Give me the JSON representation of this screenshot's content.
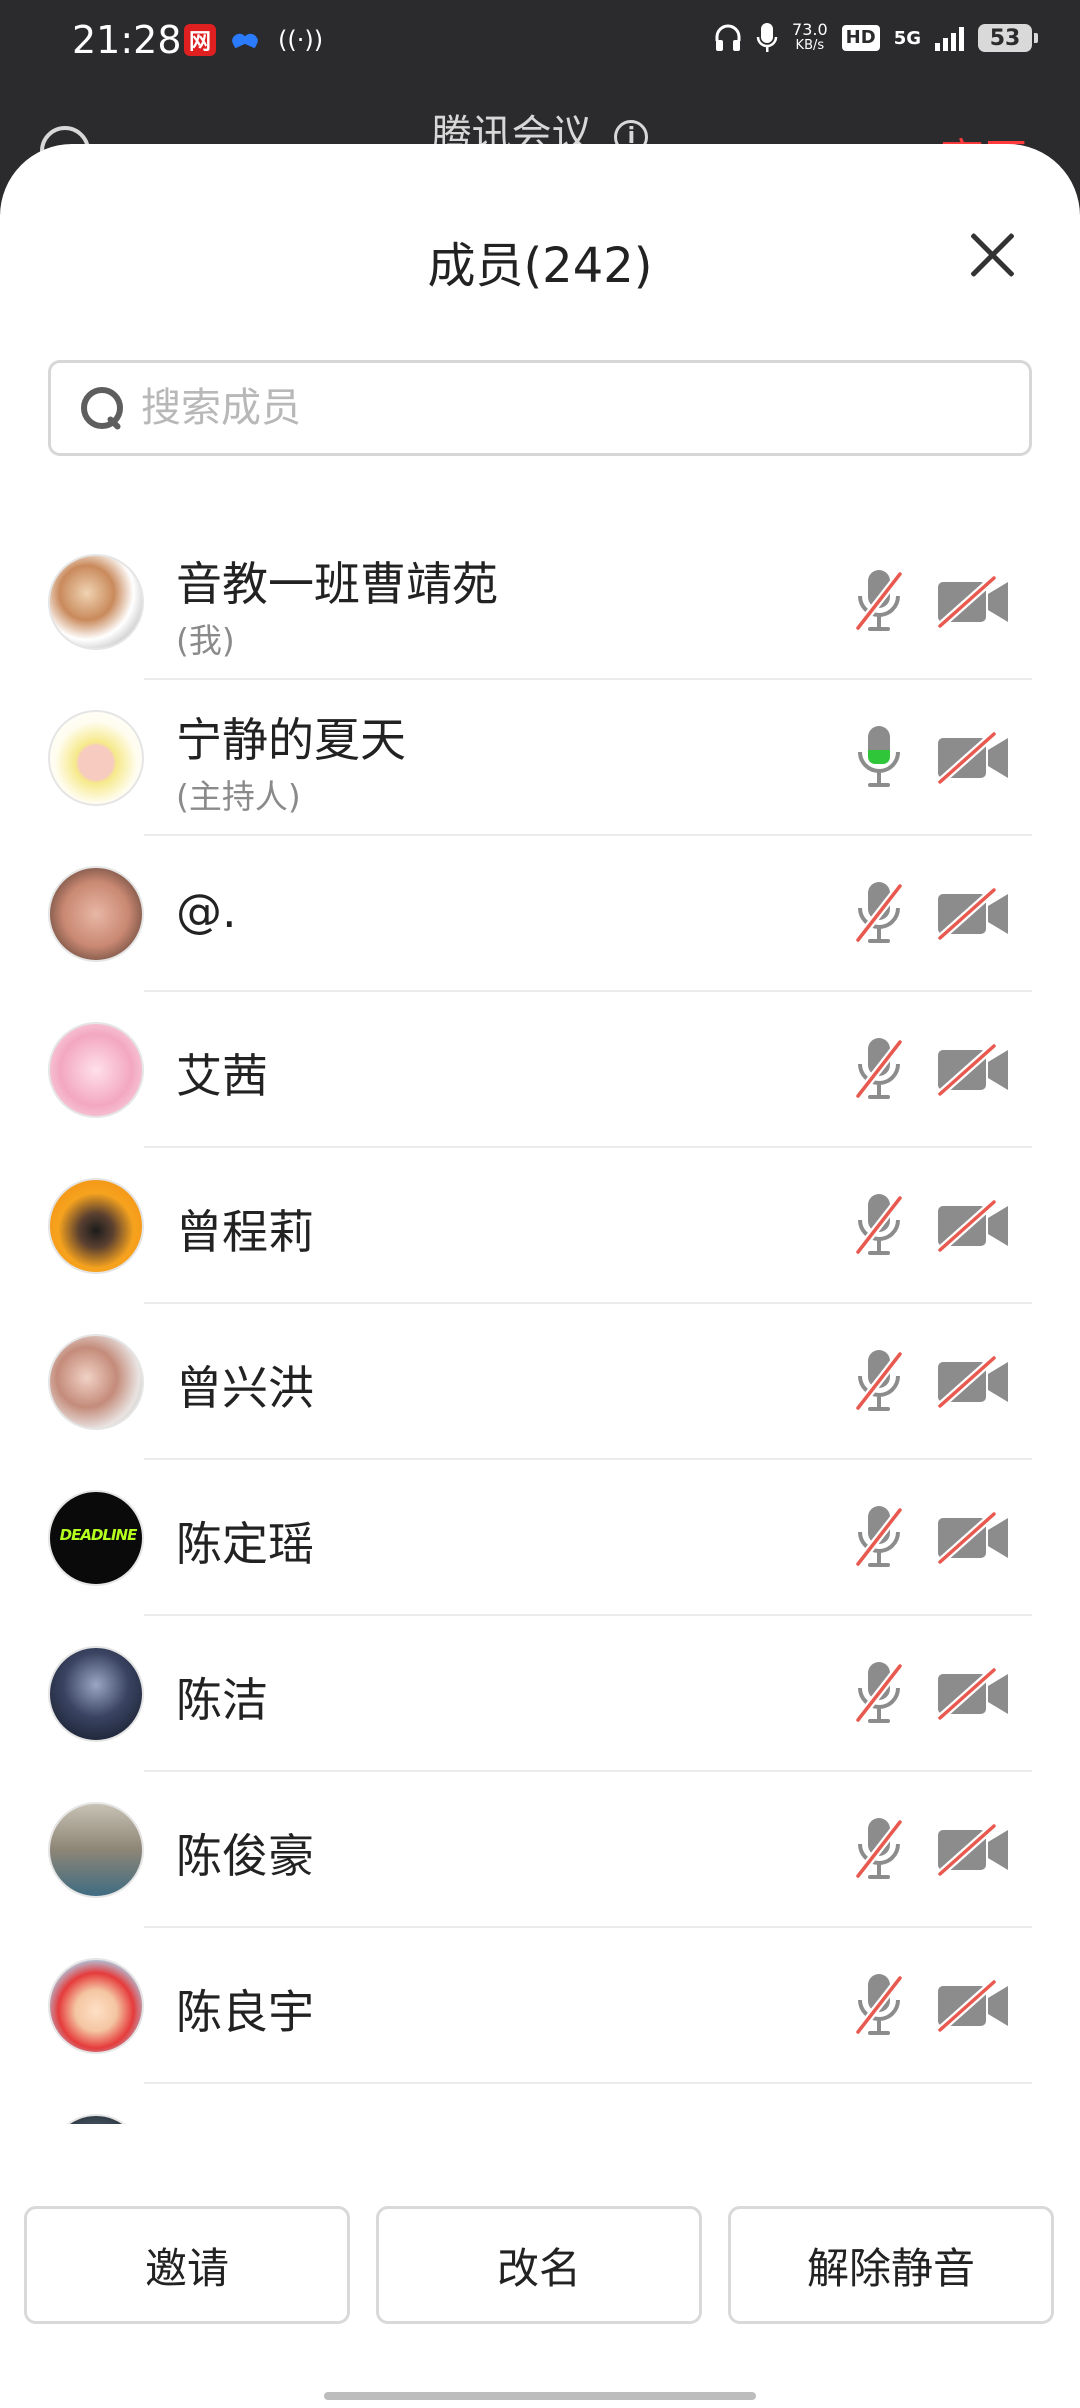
{
  "status_bar": {
    "time": "21:28",
    "app_icon_red": "网",
    "hotspot": "((·))",
    "speed_top": "73.0",
    "speed_bottom": "KB/s",
    "hd": "HD",
    "network": "5G",
    "battery": "53"
  },
  "background_header": {
    "title": "腾讯会议",
    "info_icon": "i",
    "leave": "离开"
  },
  "panel": {
    "title": "成员(242)",
    "search_placeholder": "搜索成员"
  },
  "members": [
    {
      "name": "音教一班曹靖苑",
      "tag": "(我)",
      "mic": "muted",
      "camera": "off",
      "avatar": "cat-photo"
    },
    {
      "name": "宁静的夏天",
      "tag": "(主持人)",
      "mic": "on",
      "camera": "off",
      "avatar": "cartoon-girl"
    },
    {
      "name": "@.",
      "tag": "",
      "mic": "muted",
      "camera": "off",
      "avatar": "child-face"
    },
    {
      "name": "艾茜",
      "tag": "",
      "mic": "muted",
      "camera": "off",
      "avatar": "anime-pink"
    },
    {
      "name": "曾程莉",
      "tag": "",
      "mic": "muted",
      "camera": "off",
      "avatar": "group-photo-orange"
    },
    {
      "name": "曾兴洪",
      "tag": "",
      "mic": "muted",
      "camera": "off",
      "avatar": "girl-photo"
    },
    {
      "name": "陈定瑶",
      "tag": "",
      "mic": "muted",
      "camera": "off",
      "avatar": "deadline-logo",
      "avatar_text": "DEADLINE"
    },
    {
      "name": "陈洁",
      "tag": "",
      "mic": "muted",
      "camera": "off",
      "avatar": "helmet-figure"
    },
    {
      "name": "陈俊豪",
      "tag": "",
      "mic": "muted",
      "camera": "off",
      "avatar": "child-outdoor"
    },
    {
      "name": "陈良宇",
      "tag": "",
      "mic": "muted",
      "camera": "off",
      "avatar": "crayon-shin"
    },
    {
      "name": "",
      "tag": "",
      "mic": "muted",
      "camera": "off",
      "avatar": "partial"
    }
  ],
  "actions": {
    "invite": "邀请",
    "rename": "改名",
    "unmute": "解除静音"
  },
  "colors": {
    "mic_on": "#2fc63a",
    "mute_slash": "#e8594f",
    "icon_gray": "#8c8c8c",
    "leave_red": "#ff3b3b"
  }
}
